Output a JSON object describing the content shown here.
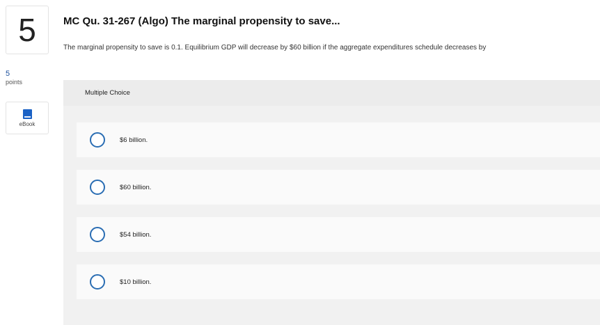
{
  "question": {
    "number": "5",
    "points_value": "5",
    "points_label": "points",
    "ebook_label": "eBook",
    "title": "MC Qu. 31-267 (Algo) The marginal propensity to save...",
    "prompt": "The marginal propensity to save is 0.1. Equilibrium GDP will decrease by $60 billion if the aggregate expenditures schedule decreases by"
  },
  "multiple_choice": {
    "header": "Multiple Choice",
    "options": [
      {
        "label": "$6 billion."
      },
      {
        "label": "$60 billion."
      },
      {
        "label": "$54 billion."
      },
      {
        "label": "$10 billion."
      }
    ]
  },
  "colors": {
    "accent": "#2a6db3",
    "points": "#1b4f9c",
    "ebook_icon": "#1b62c5"
  }
}
